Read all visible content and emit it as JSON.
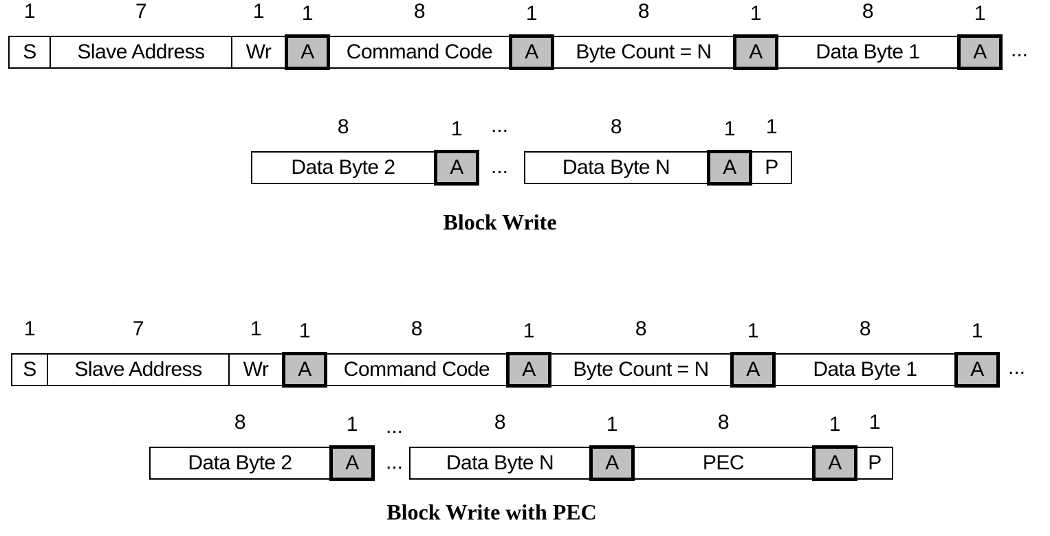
{
  "diagrams": [
    {
      "title": "Block Write",
      "row1": [
        {
          "label": "S",
          "bits": "1",
          "ack": false
        },
        {
          "label": "Slave Address",
          "bits": "7",
          "ack": false
        },
        {
          "label": "Wr",
          "bits": "1",
          "ack": false
        },
        {
          "label": "A",
          "bits": "1",
          "ack": true
        },
        {
          "label": "Command Code",
          "bits": "8",
          "ack": false
        },
        {
          "label": "A",
          "bits": "1",
          "ack": true
        },
        {
          "label": "Byte Count = N",
          "bits": "8",
          "ack": false
        },
        {
          "label": "A",
          "bits": "1",
          "ack": true
        },
        {
          "label": "Data Byte 1",
          "bits": "8",
          "ack": false
        },
        {
          "label": "A",
          "bits": "1",
          "ack": true
        }
      ],
      "row1_continuation": "...",
      "row2_group1": [
        {
          "label": "Data Byte 2",
          "bits": "8",
          "ack": false
        },
        {
          "label": "A",
          "bits": "1",
          "ack": true
        }
      ],
      "row2_gap": "...",
      "row2_gap_bits": "...",
      "row2_group2": [
        {
          "label": "Data Byte N",
          "bits": "8",
          "ack": false
        },
        {
          "label": "A",
          "bits": "1",
          "ack": true
        },
        {
          "label": "P",
          "bits": "1",
          "ack": false
        }
      ]
    },
    {
      "title": "Block Write with PEC",
      "row1": [
        {
          "label": "S",
          "bits": "1",
          "ack": false
        },
        {
          "label": "Slave Address",
          "bits": "7",
          "ack": false
        },
        {
          "label": "Wr",
          "bits": "1",
          "ack": false
        },
        {
          "label": "A",
          "bits": "1",
          "ack": true
        },
        {
          "label": "Command Code",
          "bits": "8",
          "ack": false
        },
        {
          "label": "A",
          "bits": "1",
          "ack": true
        },
        {
          "label": "Byte Count = N",
          "bits": "8",
          "ack": false
        },
        {
          "label": "A",
          "bits": "1",
          "ack": true
        },
        {
          "label": "Data Byte 1",
          "bits": "8",
          "ack": false
        },
        {
          "label": "A",
          "bits": "1",
          "ack": true
        }
      ],
      "row1_continuation": "...",
      "row2_group1": [
        {
          "label": "Data Byte 2",
          "bits": "8",
          "ack": false
        },
        {
          "label": "A",
          "bits": "1",
          "ack": true
        }
      ],
      "row2_gap": "...",
      "row2_gap_bits": "...",
      "row2_group2": [
        {
          "label": "Data Byte N",
          "bits": "8",
          "ack": false
        },
        {
          "label": "A",
          "bits": "1",
          "ack": true
        },
        {
          "label": "PEC",
          "bits": "8",
          "ack": false
        },
        {
          "label": "A",
          "bits": "1",
          "ack": true
        },
        {
          "label": "P",
          "bits": "1",
          "ack": false
        }
      ]
    }
  ],
  "colors": {
    "ack_fill": "#c0c0c0",
    "border": "#000000",
    "field_fill": "#ffffff"
  }
}
